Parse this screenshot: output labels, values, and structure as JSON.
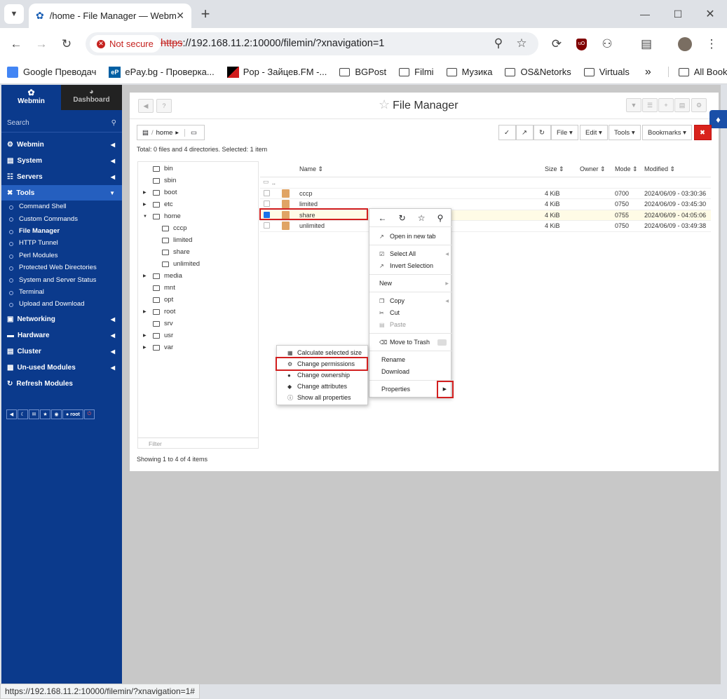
{
  "browser": {
    "tab_title": "/home - File Manager — Webmin",
    "security_label": "Not secure",
    "url_scheme": "https",
    "url_rest": "://192.168.11.2:10000/filemin/?xnavigation=1",
    "status_url": "https://192.168.11.2:10000/filemin/?xnavigation=1#",
    "bookmarks": [
      {
        "label": "Google Преводач"
      },
      {
        "label": "ePay.bg - Проверка..."
      },
      {
        "label": "Pop - Зайцев.FM -..."
      },
      {
        "label": "BGPost"
      },
      {
        "label": "Filmi"
      },
      {
        "label": "Музика"
      },
      {
        "label": "OS&Netorks"
      },
      {
        "label": "Virtuals"
      }
    ],
    "bookmarks_overflow": "»",
    "all_bookmarks": "All Bookmarks"
  },
  "sidebar": {
    "webmin_tab": "Webmin",
    "dashboard_tab": "Dashboard",
    "search_placeholder": "Search",
    "menus": [
      {
        "label": "Webmin"
      },
      {
        "label": "System"
      },
      {
        "label": "Servers"
      },
      {
        "label": "Tools"
      }
    ],
    "tools_items": [
      {
        "label": "Command Shell"
      },
      {
        "label": "Custom Commands"
      },
      {
        "label": "File Manager"
      },
      {
        "label": "HTTP Tunnel"
      },
      {
        "label": "Perl Modules"
      },
      {
        "label": "Protected Web Directories"
      },
      {
        "label": "System and Server Status"
      },
      {
        "label": "Terminal"
      },
      {
        "label": "Upload and Download"
      }
    ],
    "menus_after": [
      {
        "label": "Networking"
      },
      {
        "label": "Hardware"
      },
      {
        "label": "Cluster"
      },
      {
        "label": "Un-used Modules"
      },
      {
        "label": "Refresh Modules"
      }
    ],
    "user": "root"
  },
  "filemanager": {
    "title": "File Manager",
    "breadcrumb": "home",
    "toolbar": {
      "file": "File",
      "edit": "Edit",
      "tools": "Tools",
      "bookmarks": "Bookmarks"
    },
    "total": "Total: 0 files and 4 directories. Selected: 1 item",
    "showing": "Showing 1 to 4 of 4 items",
    "filter_placeholder": "Filter",
    "tree": [
      "bin",
      "sbin",
      "boot",
      "etc",
      "home",
      "cccp",
      "limited",
      "share",
      "unlimited",
      "media",
      "mnt",
      "opt",
      "root",
      "srv",
      "usr",
      "var"
    ],
    "columns": {
      "name": "Name",
      "size": "Size",
      "owner": "Owner",
      "mode": "Mode",
      "modified": "Modified"
    },
    "parent": "..",
    "rows": [
      {
        "name": "cccp",
        "size": "4 KiB",
        "mode": "0700",
        "modified": "2024/06/09 - 03:30:36"
      },
      {
        "name": "limited",
        "size": "4 KiB",
        "mode": "0750",
        "modified": "2024/06/09 - 03:45:30"
      },
      {
        "name": "share",
        "size": "4 KiB",
        "mode": "0755",
        "modified": "2024/06/09 - 04:05:06"
      },
      {
        "name": "unlimited",
        "size": "4 KiB",
        "mode": "0750",
        "modified": "2024/06/09 - 03:49:38"
      }
    ]
  },
  "context_menu": {
    "open_new_tab": "Open in new tab",
    "select_all": "Select All",
    "invert_selection": "Invert Selection",
    "new": "New",
    "copy": "Copy",
    "cut": "Cut",
    "paste": "Paste",
    "move_to_trash": "Move to Trash",
    "rename": "Rename",
    "download": "Download",
    "properties": "Properties"
  },
  "submenu": {
    "calculate": "Calculate selected size",
    "permissions": "Change permissions",
    "ownership": "Change ownership",
    "attributes": "Change attributes",
    "show_all": "Show all properties"
  }
}
